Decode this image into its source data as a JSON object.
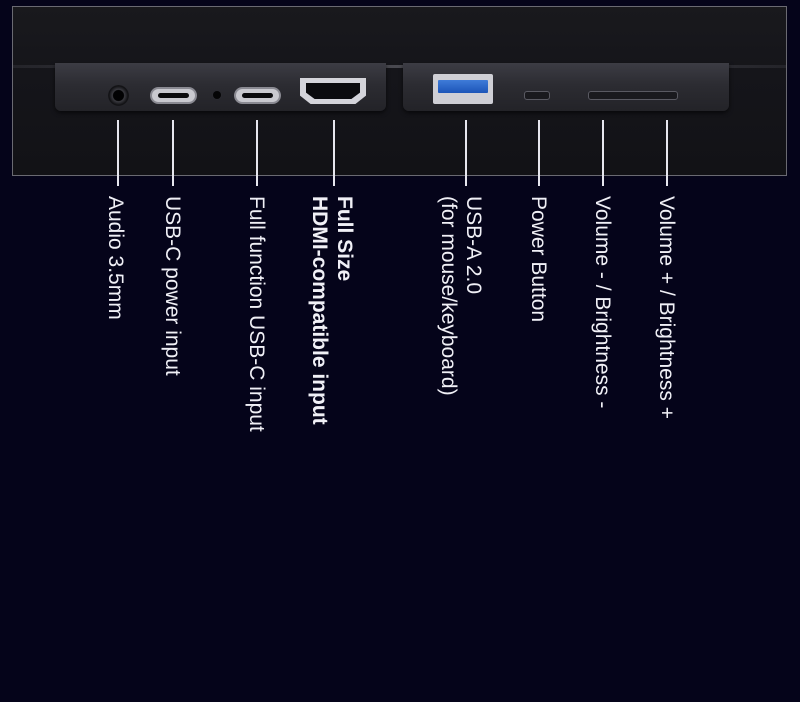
{
  "ports": [
    {
      "id": "audio",
      "label_lines": [
        "Audio 3.5mm"
      ],
      "bold": false
    },
    {
      "id": "usbc-power",
      "label_lines": [
        "USB-C power input"
      ],
      "bold": false
    },
    {
      "id": "usbc-full",
      "label_lines": [
        "Full function USB-C input"
      ],
      "bold": false
    },
    {
      "id": "hdmi",
      "label_lines": [
        "Full Size",
        "HDMI-compatible input"
      ],
      "bold": true
    },
    {
      "id": "usba",
      "label_lines": [
        "USB-A 2.0",
        "(for mouse/keyboard)"
      ],
      "bold": false
    },
    {
      "id": "power",
      "label_lines": [
        "Power Button"
      ],
      "bold": false
    },
    {
      "id": "vol-down",
      "label_lines": [
        "Volume - / Brightness -"
      ],
      "bold": false
    },
    {
      "id": "vol-up",
      "label_lines": [
        "Volume + / Brightness +"
      ],
      "bold": false
    }
  ],
  "colors": {
    "background": "#05041a",
    "usb_a_tongue": "#1c55b8",
    "label_text": "#f0f0f6"
  }
}
